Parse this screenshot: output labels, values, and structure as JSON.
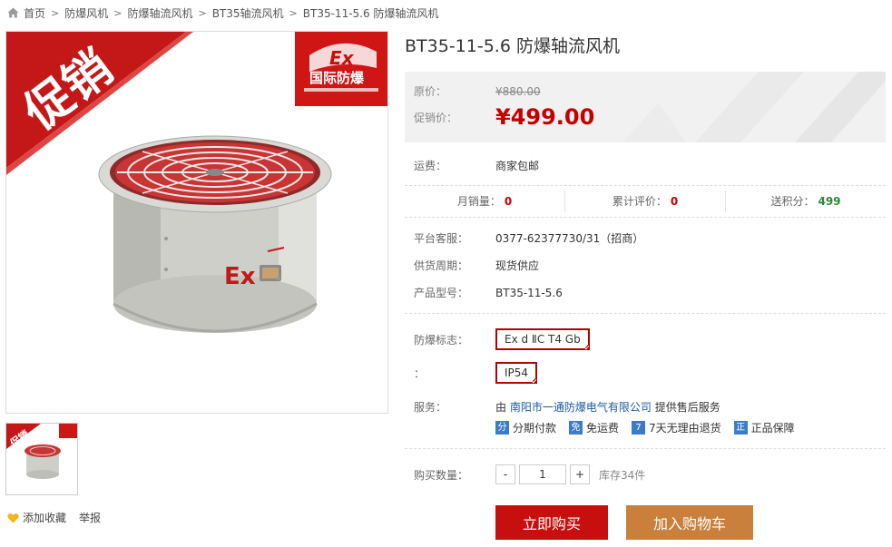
{
  "breadcrumb": [
    "首页",
    "防爆风机",
    "防爆轴流风机",
    "BT35轴流风机",
    "BT35-11-5.6 防爆轴流风机"
  ],
  "gallery": {
    "main_banner": "促销",
    "badge_text": "国际防爆",
    "badge_ex": "Ex",
    "product_mark": "Ex",
    "thumb_banner": "促销"
  },
  "actions": {
    "favorite": "添加收藏",
    "report": "举报"
  },
  "product": {
    "title": "BT35-11-5.6 防爆轴流风机",
    "original_price_label": "原价：",
    "original_price": "¥880.00",
    "promo_price_label": "促销价：",
    "promo_price": "¥499.00",
    "shipping_label": "运费：",
    "shipping": "商家包邮",
    "stats": [
      {
        "label": "月销量：",
        "value": "0"
      },
      {
        "label": "累计评价：",
        "value": "0"
      },
      {
        "label": "送积分：",
        "value": "499"
      }
    ],
    "service_phone_label": "平台客服：",
    "service_phone": "0377-62377730/31（招商）",
    "supply_label": "供货周期：",
    "supply": "现货供应",
    "model_label": "产品型号：",
    "model": "BT35-11-5.6",
    "ex_mark_label": "防爆标志：",
    "ex_mark": "Ex d ⅡC T4 Gb",
    "ip_label": "：",
    "ip": "IP54",
    "service_label": "服务：",
    "service_prefix": "由",
    "service_company": "南阳市一通防爆电气有限公司",
    "service_suffix": "提供售后服务",
    "guarantees": [
      {
        "icon": "分",
        "label": "分期付款",
        "color": "#3c7cc4"
      },
      {
        "icon": "免",
        "label": "免运费",
        "color": "#3c7cc4"
      },
      {
        "icon": "7",
        "label": "7天无理由退货",
        "color": "#3c7cc4"
      },
      {
        "icon": "正",
        "label": "正品保障",
        "color": "#3c7cc4"
      }
    ],
    "quantity_label": "购买数量：",
    "quantity_minus": "-",
    "quantity": "1",
    "quantity_plus": "+",
    "stock": "库存34件",
    "buy_now": "立即购买",
    "add_to_cart": "加入购物车"
  },
  "colors": {
    "accent_red": "#c80f0f",
    "price_red": "#c40000",
    "cart_brown": "#c8803c",
    "link_blue": "#1a5aa6"
  }
}
